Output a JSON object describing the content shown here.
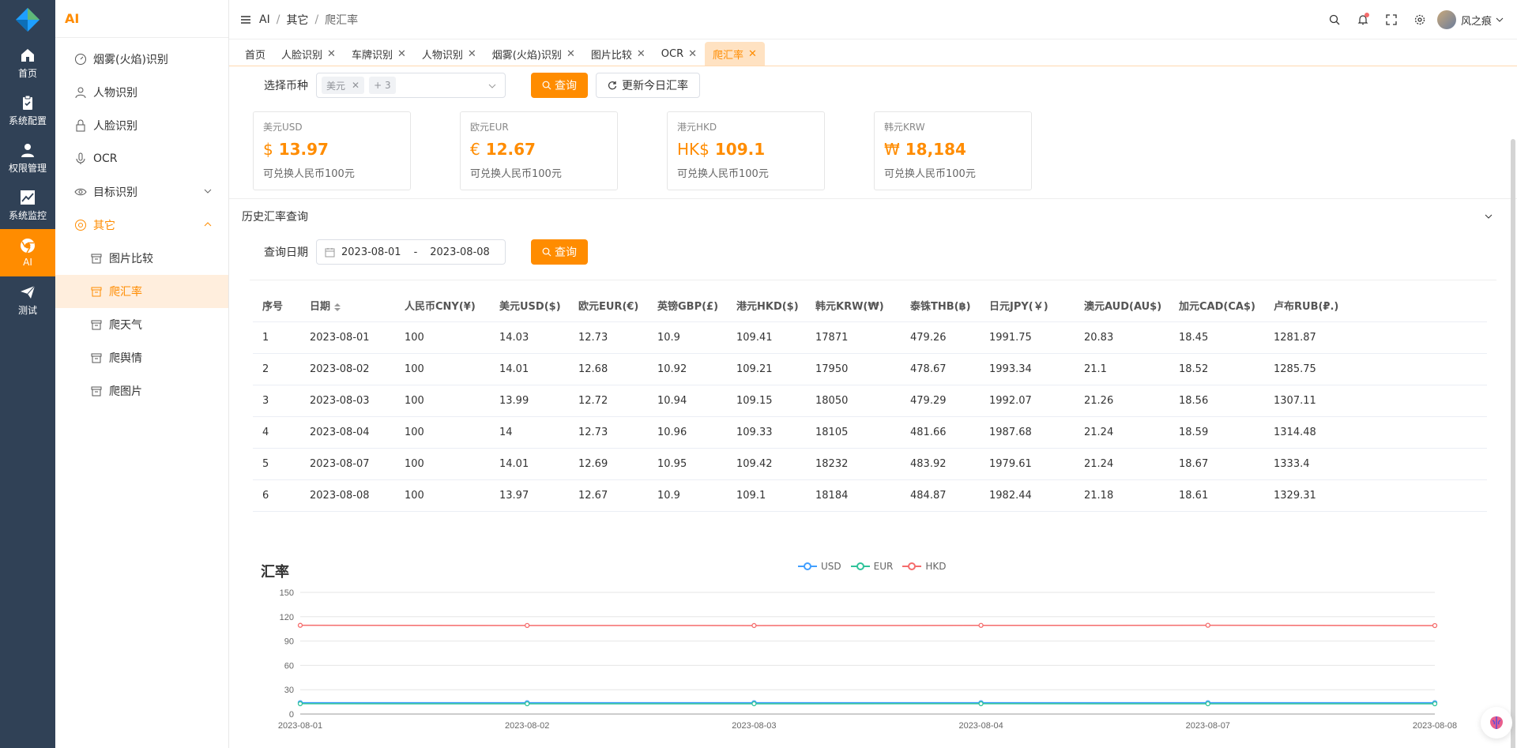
{
  "rail": [
    {
      "label": "首页",
      "icon": "home-icon"
    },
    {
      "label": "系统配置",
      "icon": "clipboard-icon"
    },
    {
      "label": "权限管理",
      "icon": "user-icon"
    },
    {
      "label": "系统监控",
      "icon": "chart-icon"
    },
    {
      "label": "AI",
      "icon": "chrome-icon",
      "active": true
    },
    {
      "label": "测试",
      "icon": "send-icon"
    }
  ],
  "sidebar": {
    "title": "AI",
    "items": [
      {
        "label": "烟雾(火焰)识别"
      },
      {
        "label": "人物识别"
      },
      {
        "label": "人脸识别"
      },
      {
        "label": "OCR"
      },
      {
        "label": "目标识别"
      },
      {
        "label": "其它"
      },
      {
        "label": "图片比较"
      },
      {
        "label": "爬汇率"
      },
      {
        "label": "爬天气"
      },
      {
        "label": "爬舆情"
      },
      {
        "label": "爬图片"
      }
    ]
  },
  "breadcrumb": {
    "a": "AI",
    "b": "其它",
    "c": "爬汇率",
    "sep": "/"
  },
  "user": {
    "name": "风之痕"
  },
  "tabs": [
    {
      "label": "首页"
    },
    {
      "label": "人脸识别"
    },
    {
      "label": "车牌识别"
    },
    {
      "label": "人物识别"
    },
    {
      "label": "烟雾(火焰)识别"
    },
    {
      "label": "图片比较"
    },
    {
      "label": "OCR"
    },
    {
      "label": "爬汇率"
    }
  ],
  "filter": {
    "label": "选择币种",
    "chip": "美元",
    "more": "+ 3",
    "query_label": "查询",
    "update_label": "更新今日汇率"
  },
  "cards": [
    {
      "name": "美元USD",
      "symbol": "$",
      "value": "13.97",
      "desc": "可兑换人民币100元"
    },
    {
      "name": "欧元EUR",
      "symbol": "€",
      "value": "12.67",
      "desc": "可兑换人民币100元"
    },
    {
      "name": "港元HKD",
      "symbol": "HK$",
      "value": "109.1",
      "desc": "可兑换人民币100元"
    },
    {
      "name": "韩元KRW",
      "symbol": "₩",
      "value": "18,184",
      "desc": "可兑换人民币100元"
    }
  ],
  "history": {
    "title": "历史汇率查询",
    "date_label": "查询日期",
    "start": "2023-08-01",
    "dash": "-",
    "end": "2023-08-08",
    "query_label": "查询"
  },
  "table": {
    "headers": [
      "序号",
      "日期",
      "人民币CNY(¥)",
      "美元USD($)",
      "欧元EUR(€)",
      "英镑GBP(£)",
      "港元HKD($)",
      "韩元KRW(₩)",
      "泰铢THB(฿)",
      "日元JPY(￥)",
      "澳元AUD(AU$)",
      "加元CAD(CA$)",
      "卢布RUB(₽.)"
    ],
    "rows": [
      [
        "1",
        "2023-08-01",
        "100",
        "14.03",
        "12.73",
        "10.9",
        "109.41",
        "17871",
        "479.26",
        "1991.75",
        "20.83",
        "18.45",
        "1281.87"
      ],
      [
        "2",
        "2023-08-02",
        "100",
        "14.01",
        "12.68",
        "10.92",
        "109.21",
        "17950",
        "478.67",
        "1993.34",
        "21.1",
        "18.52",
        "1285.75"
      ],
      [
        "3",
        "2023-08-03",
        "100",
        "13.99",
        "12.72",
        "10.94",
        "109.15",
        "18050",
        "479.29",
        "1992.07",
        "21.26",
        "18.56",
        "1307.11"
      ],
      [
        "4",
        "2023-08-04",
        "100",
        "14",
        "12.73",
        "10.96",
        "109.33",
        "18105",
        "481.66",
        "1987.68",
        "21.24",
        "18.59",
        "1314.48"
      ],
      [
        "5",
        "2023-08-07",
        "100",
        "14.01",
        "12.69",
        "10.95",
        "109.42",
        "18232",
        "483.92",
        "1979.61",
        "21.24",
        "18.67",
        "1333.4"
      ],
      [
        "6",
        "2023-08-08",
        "100",
        "13.97",
        "12.67",
        "10.9",
        "109.1",
        "18184",
        "484.87",
        "1982.44",
        "21.18",
        "18.61",
        "1329.31"
      ]
    ]
  },
  "chart_data": {
    "type": "line",
    "title": "汇率",
    "x": [
      "2023-08-01",
      "2023-08-02",
      "2023-08-03",
      "2023-08-04",
      "2023-08-07",
      "2023-08-08"
    ],
    "series": [
      {
        "name": "USD",
        "color": "#409eff",
        "values": [
          14.03,
          14.01,
          13.99,
          14,
          14.01,
          13.97
        ]
      },
      {
        "name": "EUR",
        "color": "#2fc39a",
        "values": [
          12.73,
          12.68,
          12.72,
          12.73,
          12.69,
          12.67
        ]
      },
      {
        "name": "HKD",
        "color": "#f56c6c",
        "values": [
          109.41,
          109.21,
          109.15,
          109.33,
          109.42,
          109.1
        ]
      }
    ],
    "yticks": [
      0,
      30,
      60,
      90,
      120,
      150
    ],
    "ylim": [
      0,
      150
    ],
    "legend": "top-center",
    "grid": true
  },
  "colors": {
    "accent": "#ff8c00",
    "rail": "#304156"
  }
}
